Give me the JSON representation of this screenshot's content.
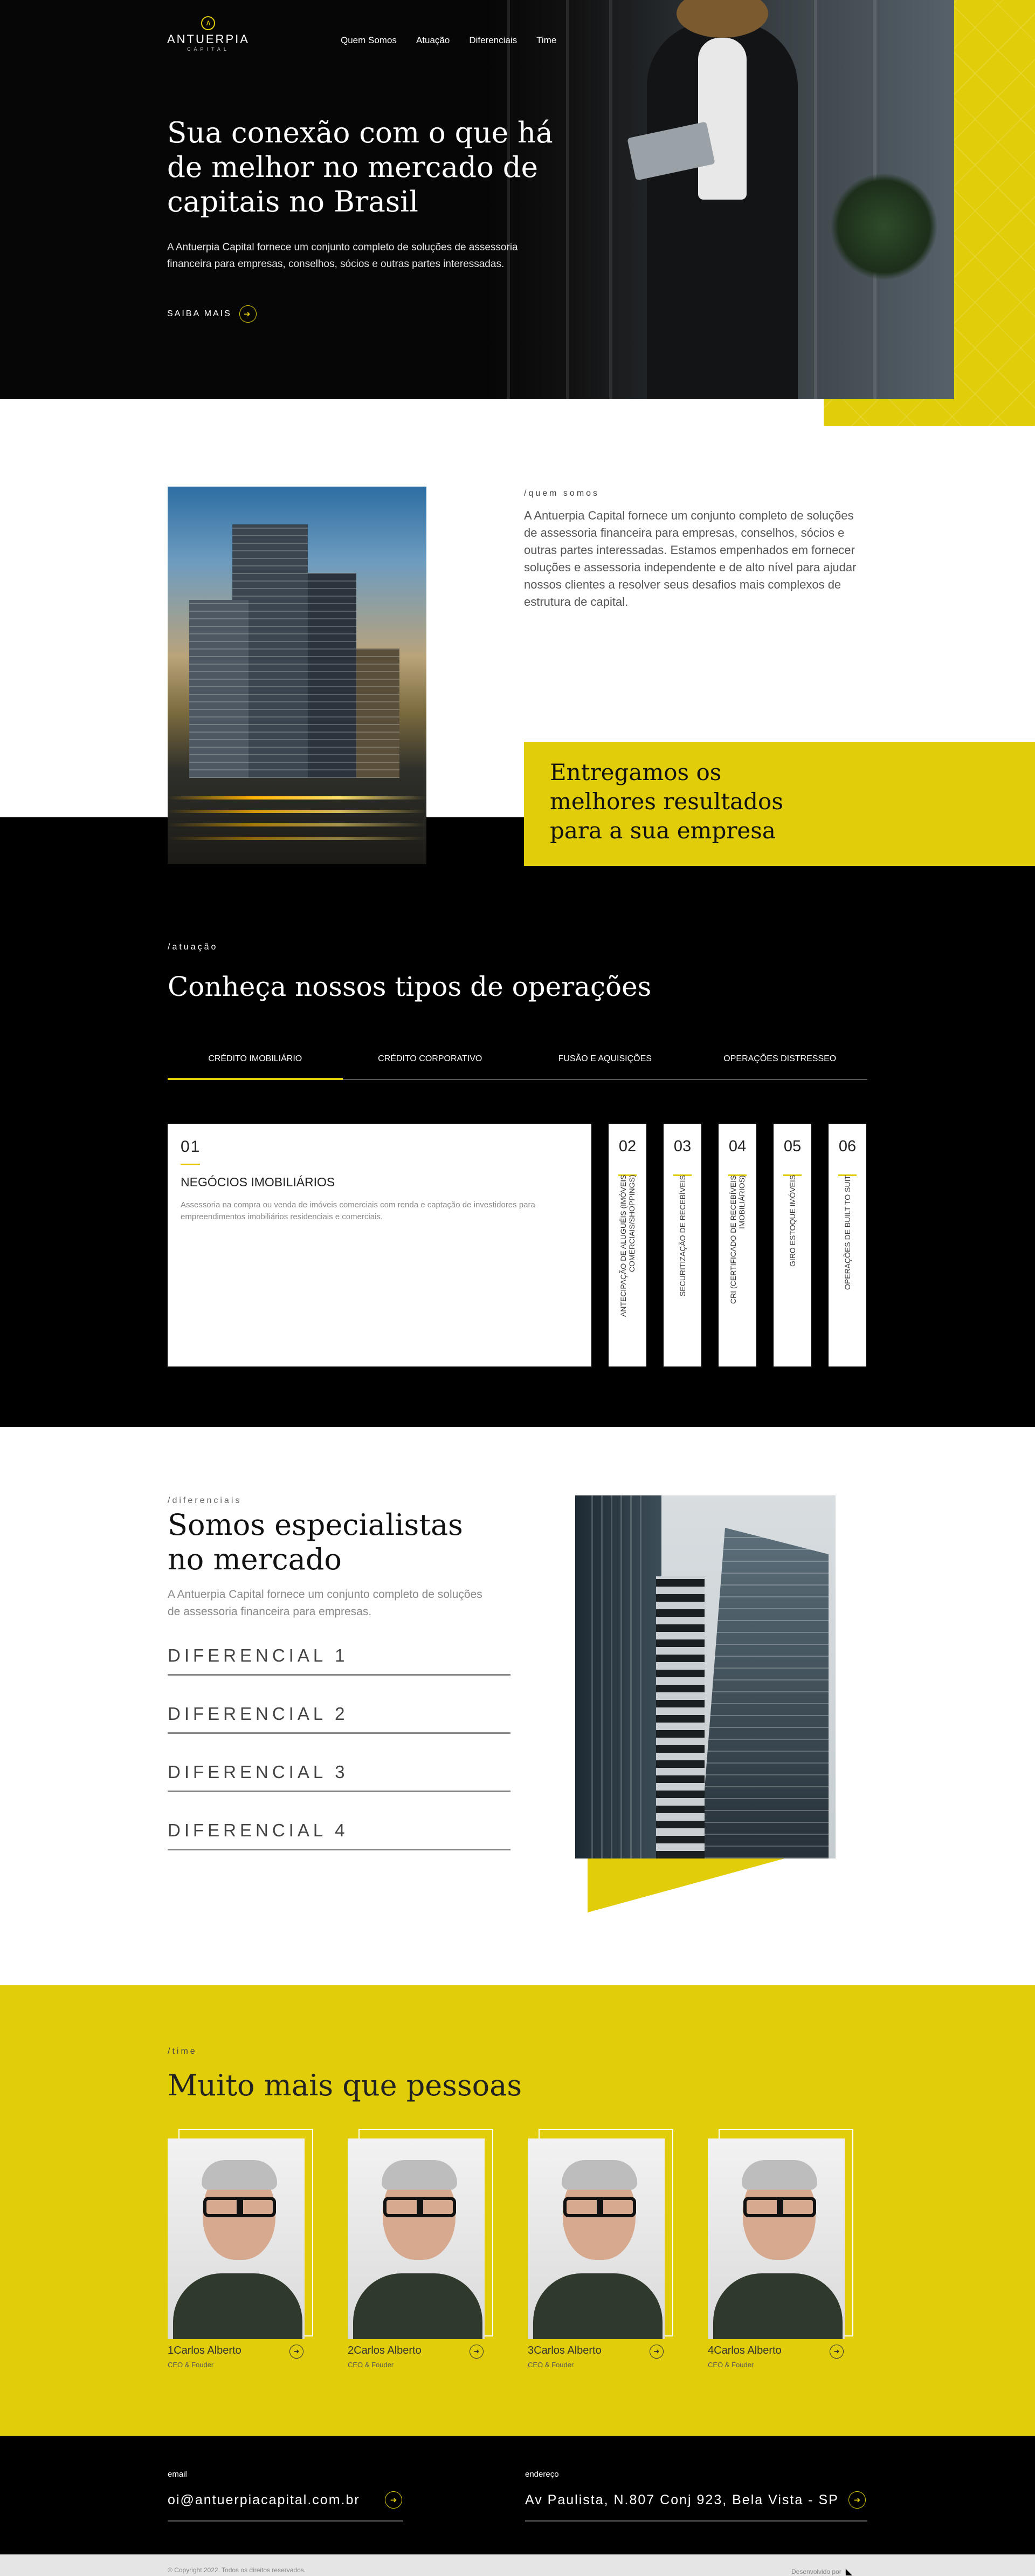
{
  "brand": {
    "name": "ANTUERPIA",
    "sub": "CAPITAL",
    "logo_icon": "a-letter-mark-icon",
    "accent": "#e1cd09"
  },
  "nav": {
    "items": [
      "Quem Somos",
      "Atuação",
      "Diferenciais",
      "Time"
    ]
  },
  "hero": {
    "title": "Sua conexão com o que há de melhor no mercado de capitais no Brasil",
    "description": "A Antuerpia Capital fornece um conjunto completo de soluções de assessoria financeira para empresas, conselhos, sócios e outras partes interessadas.",
    "cta": "SAIBA MAIS"
  },
  "quem_somos": {
    "eyebrow": "/quem somos",
    "text": "A Antuerpia Capital fornece um conjunto completo de soluções de assessoria financeira para empresas, conselhos, sócios e outras partes interessadas. Estamos empenhados em fornecer soluções e assessoria independente e de alto nível para ajudar nossos clientes a resolver seus desafios mais complexos de estrutura de capital.",
    "highlight": "Entregamos os melhores resultados para a sua empresa"
  },
  "atuacao": {
    "eyebrow": "/atuação",
    "title": "Conheça nossos tipos de operações",
    "tabs": [
      "CRÉDITO IMOBILIÁRIO",
      "CRÉDITO CORPORATIVO",
      "FUSÃO E AQUISIÇÕES",
      "OPERAÇÕES DISTRESSEO"
    ],
    "active_tab": 0,
    "main_card": {
      "number": "01",
      "title": "NEGÓCIOS IMOBILIÁRIOS",
      "description": "Assessoria na compra ou venda de imóveis comerciais com renda e captação de investidores para empreendimentos imobiliários residenciais e comerciais."
    },
    "columns": [
      {
        "number": "02",
        "label": "ANTECIPAÇÃO DE ALUGUÉIS (IMÓVEIS COMERCIAIS/SHOPPINGS)"
      },
      {
        "number": "03",
        "label": "SECURITIZAÇÃO DE RECEBÍVEIS"
      },
      {
        "number": "04",
        "label": "CRI (CERTIFICADO DE RECEBÍVEIS IMOBILIÁRIOS)"
      },
      {
        "number": "05",
        "label": "GIRO ESTOQUE IMÓVEIS"
      },
      {
        "number": "06",
        "label": "OPERAÇÕES DE BUILT TO SUIT"
      }
    ]
  },
  "diferenciais": {
    "eyebrow": "/diferenciais",
    "title": "Somos especialistas no mercado",
    "description": "A Antuerpia Capital fornece um conjunto completo de soluções de assessoria financeira para empresas.",
    "items": [
      "DIFERENCIAL 1",
      "DIFERENCIAL 2",
      "DIFERENCIAL 3",
      "DIFERENCIAL 4"
    ]
  },
  "time": {
    "eyebrow": "/time",
    "title": "Muito mais que pessoas",
    "members": [
      {
        "name": "1Carlos Alberto",
        "role": "CEO & Fouder"
      },
      {
        "name": "2Carlos Alberto",
        "role": "CEO & Fouder"
      },
      {
        "name": "3Carlos Alberto",
        "role": "CEO & Fouder"
      },
      {
        "name": "4Carlos Alberto",
        "role": "CEO & Fouder"
      }
    ]
  },
  "footer": {
    "email_label": "email",
    "email": "oi@antuerpiacapital.com.br",
    "address_label": "endereço",
    "address": "Av Paulista, N.807 Conj 923, Bela Vista - SP",
    "copyright": "© Copyright 2022. Todos os direitos reservados.",
    "developed_by": "Desenvolvido por"
  }
}
